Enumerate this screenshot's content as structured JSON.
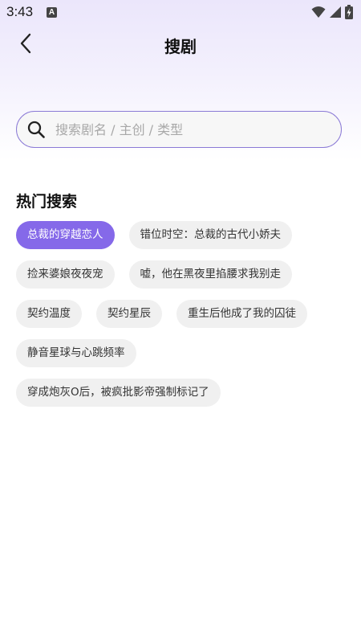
{
  "status_bar": {
    "time": "3:43",
    "notification_icon": "a-icon",
    "wifi_icon": "wifi-icon",
    "signal_icon": "signal-icon",
    "battery_icon": "battery-charging-icon"
  },
  "header": {
    "title": "搜剧",
    "back_icon": "chevron-left-icon"
  },
  "search": {
    "placeholder": "搜索剧名 / 主创 / 类型",
    "value": "",
    "icon": "search-icon"
  },
  "hot": {
    "title": "热门搜索",
    "tags": [
      {
        "label": "总裁的穿越恋人",
        "active": true
      },
      {
        "label": "错位时空：总裁的古代小娇夫",
        "active": false
      },
      {
        "label": "捡来婆娘夜夜宠",
        "active": false
      },
      {
        "label": "嘘，他在黑夜里掐腰求我别走",
        "active": false
      },
      {
        "label": "契约温度",
        "active": false
      },
      {
        "label": "契约星辰",
        "active": false
      },
      {
        "label": "重生后他成了我的囚徒",
        "active": false
      },
      {
        "label": "静音星球与心跳频率",
        "active": false
      },
      {
        "label": "穿成炮灰O后，被疯批影帝强制标记了",
        "active": false
      }
    ]
  },
  "colors": {
    "accent": "#8569e9",
    "search_border": "#8b7ad6",
    "tag_bg": "#f0f0f0",
    "gradient_top": "#ebe6fb"
  }
}
